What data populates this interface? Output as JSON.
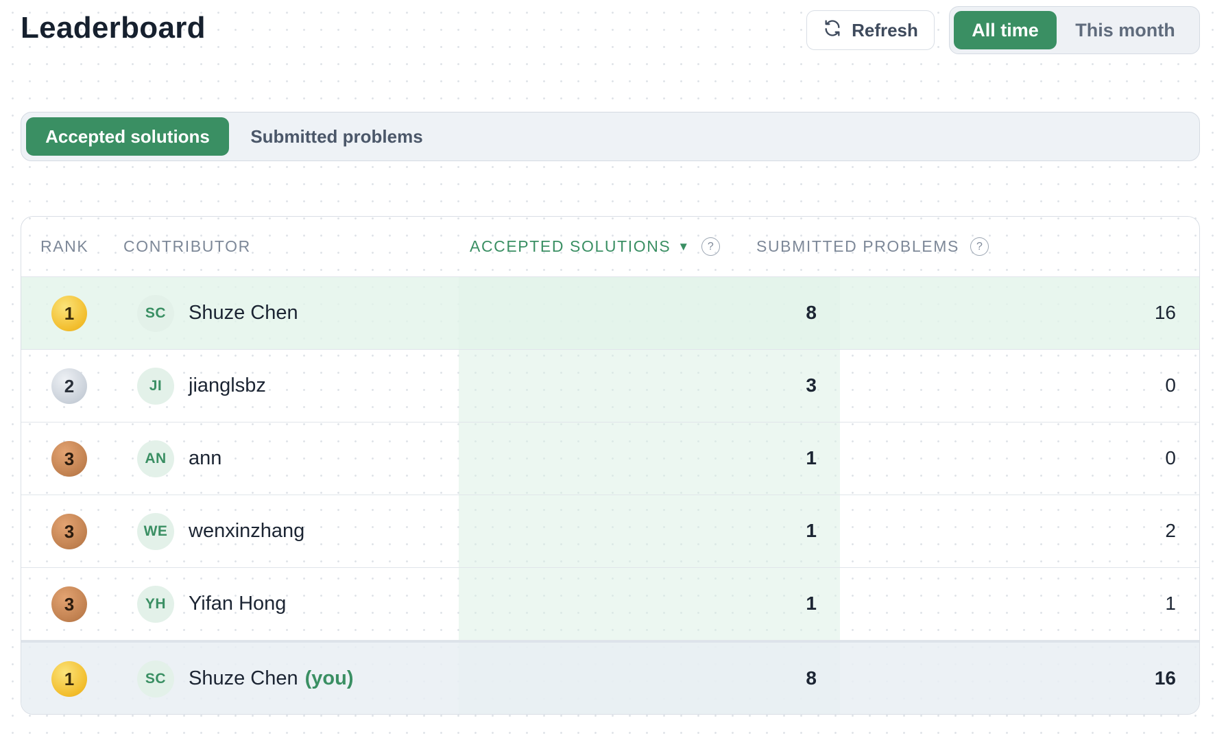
{
  "header": {
    "title": "Leaderboard",
    "refresh_label": "Refresh",
    "range_options": [
      "All time",
      "This month"
    ],
    "range_selected": "All time"
  },
  "metric_tabs": {
    "items": [
      "Accepted solutions",
      "Submitted problems"
    ],
    "selected": "Accepted solutions"
  },
  "table": {
    "columns": {
      "rank": "RANK",
      "contributor": "CONTRIBUTOR",
      "accepted": "ACCEPTED SOLUTIONS",
      "submitted": "SUBMITTED PROBLEMS"
    },
    "sort_column": "accepted",
    "sort_direction": "desc",
    "help_icon_glyph": "?",
    "rows": [
      {
        "rank": "1",
        "medal": "gold",
        "initials": "SC",
        "name": "Shuze Chen",
        "accepted": "8",
        "submitted": "16"
      },
      {
        "rank": "2",
        "medal": "silver",
        "initials": "JI",
        "name": "jianglsbz",
        "accepted": "3",
        "submitted": "0"
      },
      {
        "rank": "3",
        "medal": "bronze",
        "initials": "AN",
        "name": "ann",
        "accepted": "1",
        "submitted": "0"
      },
      {
        "rank": "3",
        "medal": "bronze",
        "initials": "WE",
        "name": "wenxinzhang",
        "accepted": "1",
        "submitted": "2"
      },
      {
        "rank": "3",
        "medal": "bronze",
        "initials": "YH",
        "name": "Yifan Hong",
        "accepted": "1",
        "submitted": "1"
      }
    ],
    "you_row": {
      "rank": "1",
      "medal": "gold",
      "initials": "SC",
      "name": "Shuze Chen",
      "you_label": "(you)",
      "accepted": "8",
      "submitted": "16"
    }
  },
  "colors": {
    "accent": "#3a8f63",
    "gold": "#f2bd2c",
    "silver": "#c9d0d9",
    "bronze": "#c0804f"
  }
}
